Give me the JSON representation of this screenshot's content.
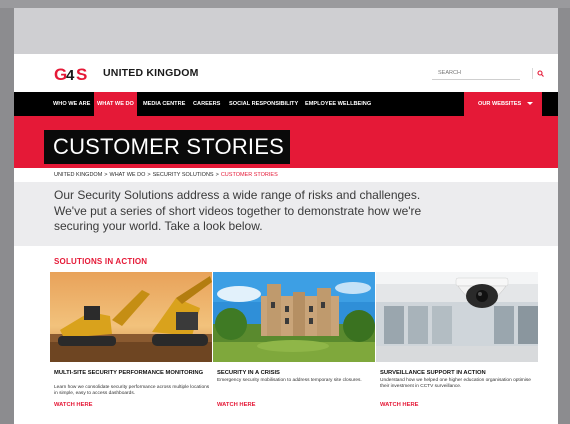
{
  "header": {
    "country": "UNITED KINGDOM",
    "search_placeholder": "SEARCH"
  },
  "nav": {
    "items": [
      {
        "label": "WHO WE ARE"
      },
      {
        "label": "WHAT WE DO"
      },
      {
        "label": "MEDIA CENTRE"
      },
      {
        "label": "CAREERS"
      },
      {
        "label": "SOCIAL RESPONSIBILITY"
      },
      {
        "label": "EMPLOYEE WELLBEING"
      }
    ],
    "active_index": 1,
    "websites_label": "OUR WEBSITES"
  },
  "hero": {
    "title": "CUSTOMER STORIES"
  },
  "breadcrumb": {
    "items": [
      "UNITED KINGDOM",
      "WHAT WE DO",
      "SECURITY SOLUTIONS",
      "CUSTOMER STORIES"
    ],
    "separator": ">"
  },
  "intro": {
    "text": "Our Security Solutions address a wide range of risks and challenges. We've put a series of short videos together to demonstrate how we're securing your world. Take a look below."
  },
  "section": {
    "title": "SOLUTIONS IN ACTION"
  },
  "cards": [
    {
      "title": "MULTI-SITE SECURITY PERFORMANCE MONITORING",
      "description": "Learn how we consolidate security performance across multiple locations in simple, easy to access dashboards.",
      "link": "WATCH HERE",
      "image": "construction-site-excavators"
    },
    {
      "title": "SECURITY IN A CRISIS",
      "description": "Emergency security mobilisation to address temporary site closures.",
      "link": "WATCH HERE",
      "image": "castle-hotel"
    },
    {
      "title": "SURVEILLANCE SUPPORT IN ACTION",
      "description": "Understand how we helped one higher education organisation optimise their investment in CCTV surveillance.",
      "link": "WATCH HERE",
      "image": "cctv-dome-camera"
    }
  ],
  "colors": {
    "brand_red": "#e51937",
    "nav_black": "#000000",
    "intro_bg": "#ececee"
  }
}
